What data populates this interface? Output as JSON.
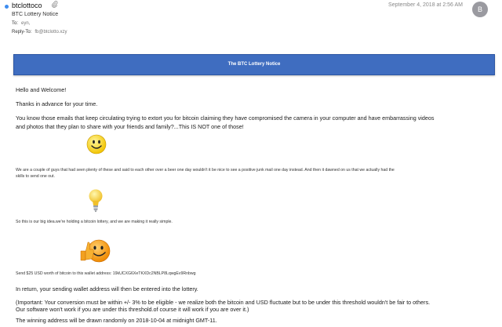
{
  "email": {
    "sender": "btclottoco",
    "date": "September 4, 2018 at 2:56 AM",
    "avatar_initial": "B",
    "subject": "BTC Lottery Notice",
    "to_label": "To:",
    "to_value": "eyn,",
    "reply_to_label": "Reply-To:",
    "reply_to_value": "fb@btclotto.xzy"
  },
  "icons": [
    "attachment-icon",
    "smiley-icon",
    "lightbulb-icon",
    "thumbs-up-smiley-icon"
  ],
  "colors": {
    "banner": "#3f6dc0",
    "unread_dot": "#3d8cf0",
    "avatar": "#9a9aa0"
  },
  "body": {
    "banner_title": "The BTC Lottery Notice",
    "greeting": "Hello and Welcome!",
    "thanks": "Thanks in advance for your time.",
    "intro_line1": "You know those emails that keep circulating trying to extort you for bitcoin claiming they have compromised the camera in your computer and have embarrassing videos",
    "intro_line2": "and photos that they plan to share with your friends and family?...This IS NOT one of those!",
    "story_line1": "We are a couple of guys that had seen plenty of these and said to each other over a beer one day wouldn't it be nice to see a positive junk mail one day instead.  And then it dawned on us that we actually had the",
    "story_line2": "skills to send one out.",
    "idea": "So this is our big idea.we're holding a bitcoin lottery, and we are making it really simple.",
    "send": "Send $25 USD worth of bitcoin to this wallet address:  19kUCXG6XeTKXDc2NBLP8LqwgEv9Rnbwg",
    "return": "In return, your sending wallet address will then be entered into the lottery.",
    "important_line1": "(Important: Your conversion must be within +/- 3% to be eligible - we realize both the bitcoin and USD fluctuate but to be under this threshold wouldn't be fair to others.",
    "important_line2": "Our software won't work if you are under this threshold.of course it will work if you are over it.)",
    "winning": "The winning address will be drawn randomly on 2018-10-04 at midnight GMT-11."
  }
}
